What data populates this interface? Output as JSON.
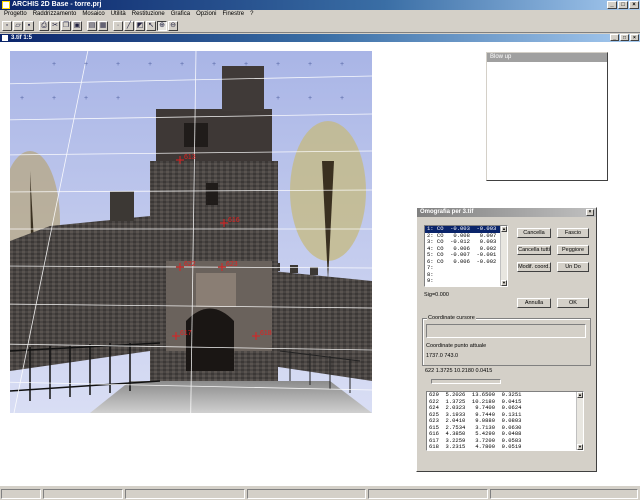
{
  "app": {
    "title": "ARCHIS 2D Base - torre.prj",
    "min_glyph": "_",
    "max_glyph": "□",
    "close_glyph": "×"
  },
  "menu": [
    "Progetto",
    "Raddrizzamento",
    "Mosaico",
    "Utilità",
    "Restituzione",
    "Grafica",
    "Opzioni",
    "Finestre",
    "?"
  ],
  "toolbar": {
    "icons": [
      "new-file-icon",
      "open-folder-icon",
      "save-icon",
      "print-icon",
      "cut-icon",
      "copy-icon",
      "paste-icon",
      "layers-icon",
      "grid-icon",
      "point-icon",
      "line-icon",
      "rectify-icon",
      "select-arrow-icon",
      "zoom-in-icon",
      "zoom-out-icon"
    ],
    "glyphs": [
      "▫",
      "▱",
      "▪",
      "⎙",
      "✂",
      "❐",
      "▣",
      "▤",
      "▦",
      "·",
      "╱",
      "◩",
      "↖",
      "⊕",
      "⊖"
    ]
  },
  "image_window": {
    "title": "3.tif 1:5"
  },
  "markers": [
    {
      "id": "613",
      "label": "613"
    },
    {
      "id": "616",
      "label": "616"
    },
    {
      "id": "622",
      "label": "622"
    },
    {
      "id": "623",
      "label": "623"
    },
    {
      "id": "617",
      "label": "617"
    },
    {
      "id": "618",
      "label": "618"
    }
  ],
  "blowup": {
    "title": "Blow up"
  },
  "dialog": {
    "title": "Omografia per 3.tif",
    "close_glyph": "×",
    "points": [
      "1: CO  -0.003  -0.003",
      "2: CO   0.008   0.007",
      "3: CO  -0.012   0.003",
      "4: CO   0.006   0.002",
      "5: CO  -0.007  -0.001",
      "6: CO   0.006  -0.002",
      "7:",
      "8:",
      "9:"
    ],
    "buttons": {
      "cancella": "Cancella",
      "fascio": "Fascio",
      "cancella_tutti": "Cancella tutti",
      "peggiore": "Peggiore",
      "modif_coord": "Modif. coord.",
      "undo": "Un Do",
      "annulla": "Annulla",
      "ok": "OK"
    },
    "sigma": "Sig=0.000",
    "group_cursor": "Coordinate cursore",
    "current_point_label": "Coordinate punto attuale",
    "current_xy": "1737.0  743.0",
    "current_detail": "622  1.3725  10.2180  0.0415",
    "coords": [
      "629  5.2026  13.6500  0.3251",
      "622  1.3725  10.2180  0.0415",
      "624  2.0323   9.7400  0.0624",
      "625  3.1933   9.7440  0.1311",
      "623  2.0410   9.0880  0.0803",
      "615  2.7534   3.7130  0.0630",
      "616  4.3850   5.4290  0.0488",
      "617  3.2259   3.7200  0.0583",
      "618  3.2315   4.7800  0.0519"
    ]
  },
  "colors": {
    "sky": "#b6c4ec",
    "marker": "#e02020",
    "title_active": "#0a246a"
  }
}
